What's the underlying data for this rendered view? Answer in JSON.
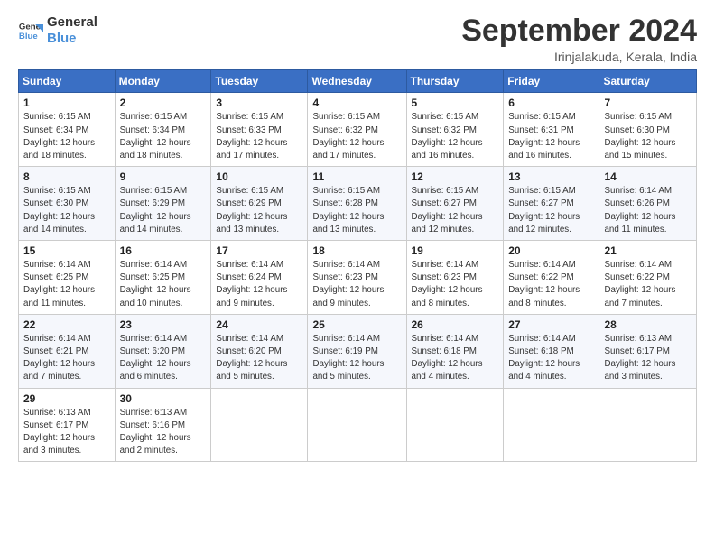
{
  "logo": {
    "line1": "General",
    "line2": "Blue"
  },
  "header": {
    "title": "September 2024",
    "subtitle": "Irinjalakuda, Kerala, India"
  },
  "weekdays": [
    "Sunday",
    "Monday",
    "Tuesday",
    "Wednesday",
    "Thursday",
    "Friday",
    "Saturday"
  ],
  "weeks": [
    [
      {
        "day": "1",
        "info": "Sunrise: 6:15 AM\nSunset: 6:34 PM\nDaylight: 12 hours\nand 18 minutes."
      },
      {
        "day": "2",
        "info": "Sunrise: 6:15 AM\nSunset: 6:34 PM\nDaylight: 12 hours\nand 18 minutes."
      },
      {
        "day": "3",
        "info": "Sunrise: 6:15 AM\nSunset: 6:33 PM\nDaylight: 12 hours\nand 17 minutes."
      },
      {
        "day": "4",
        "info": "Sunrise: 6:15 AM\nSunset: 6:32 PM\nDaylight: 12 hours\nand 17 minutes."
      },
      {
        "day": "5",
        "info": "Sunrise: 6:15 AM\nSunset: 6:32 PM\nDaylight: 12 hours\nand 16 minutes."
      },
      {
        "day": "6",
        "info": "Sunrise: 6:15 AM\nSunset: 6:31 PM\nDaylight: 12 hours\nand 16 minutes."
      },
      {
        "day": "7",
        "info": "Sunrise: 6:15 AM\nSunset: 6:30 PM\nDaylight: 12 hours\nand 15 minutes."
      }
    ],
    [
      {
        "day": "8",
        "info": "Sunrise: 6:15 AM\nSunset: 6:30 PM\nDaylight: 12 hours\nand 14 minutes."
      },
      {
        "day": "9",
        "info": "Sunrise: 6:15 AM\nSunset: 6:29 PM\nDaylight: 12 hours\nand 14 minutes."
      },
      {
        "day": "10",
        "info": "Sunrise: 6:15 AM\nSunset: 6:29 PM\nDaylight: 12 hours\nand 13 minutes."
      },
      {
        "day": "11",
        "info": "Sunrise: 6:15 AM\nSunset: 6:28 PM\nDaylight: 12 hours\nand 13 minutes."
      },
      {
        "day": "12",
        "info": "Sunrise: 6:15 AM\nSunset: 6:27 PM\nDaylight: 12 hours\nand 12 minutes."
      },
      {
        "day": "13",
        "info": "Sunrise: 6:15 AM\nSunset: 6:27 PM\nDaylight: 12 hours\nand 12 minutes."
      },
      {
        "day": "14",
        "info": "Sunrise: 6:14 AM\nSunset: 6:26 PM\nDaylight: 12 hours\nand 11 minutes."
      }
    ],
    [
      {
        "day": "15",
        "info": "Sunrise: 6:14 AM\nSunset: 6:25 PM\nDaylight: 12 hours\nand 11 minutes."
      },
      {
        "day": "16",
        "info": "Sunrise: 6:14 AM\nSunset: 6:25 PM\nDaylight: 12 hours\nand 10 minutes."
      },
      {
        "day": "17",
        "info": "Sunrise: 6:14 AM\nSunset: 6:24 PM\nDaylight: 12 hours\nand 9 minutes."
      },
      {
        "day": "18",
        "info": "Sunrise: 6:14 AM\nSunset: 6:23 PM\nDaylight: 12 hours\nand 9 minutes."
      },
      {
        "day": "19",
        "info": "Sunrise: 6:14 AM\nSunset: 6:23 PM\nDaylight: 12 hours\nand 8 minutes."
      },
      {
        "day": "20",
        "info": "Sunrise: 6:14 AM\nSunset: 6:22 PM\nDaylight: 12 hours\nand 8 minutes."
      },
      {
        "day": "21",
        "info": "Sunrise: 6:14 AM\nSunset: 6:22 PM\nDaylight: 12 hours\nand 7 minutes."
      }
    ],
    [
      {
        "day": "22",
        "info": "Sunrise: 6:14 AM\nSunset: 6:21 PM\nDaylight: 12 hours\nand 7 minutes."
      },
      {
        "day": "23",
        "info": "Sunrise: 6:14 AM\nSunset: 6:20 PM\nDaylight: 12 hours\nand 6 minutes."
      },
      {
        "day": "24",
        "info": "Sunrise: 6:14 AM\nSunset: 6:20 PM\nDaylight: 12 hours\nand 5 minutes."
      },
      {
        "day": "25",
        "info": "Sunrise: 6:14 AM\nSunset: 6:19 PM\nDaylight: 12 hours\nand 5 minutes."
      },
      {
        "day": "26",
        "info": "Sunrise: 6:14 AM\nSunset: 6:18 PM\nDaylight: 12 hours\nand 4 minutes."
      },
      {
        "day": "27",
        "info": "Sunrise: 6:14 AM\nSunset: 6:18 PM\nDaylight: 12 hours\nand 4 minutes."
      },
      {
        "day": "28",
        "info": "Sunrise: 6:13 AM\nSunset: 6:17 PM\nDaylight: 12 hours\nand 3 minutes."
      }
    ],
    [
      {
        "day": "29",
        "info": "Sunrise: 6:13 AM\nSunset: 6:17 PM\nDaylight: 12 hours\nand 3 minutes."
      },
      {
        "day": "30",
        "info": "Sunrise: 6:13 AM\nSunset: 6:16 PM\nDaylight: 12 hours\nand 2 minutes."
      },
      null,
      null,
      null,
      null,
      null
    ]
  ]
}
